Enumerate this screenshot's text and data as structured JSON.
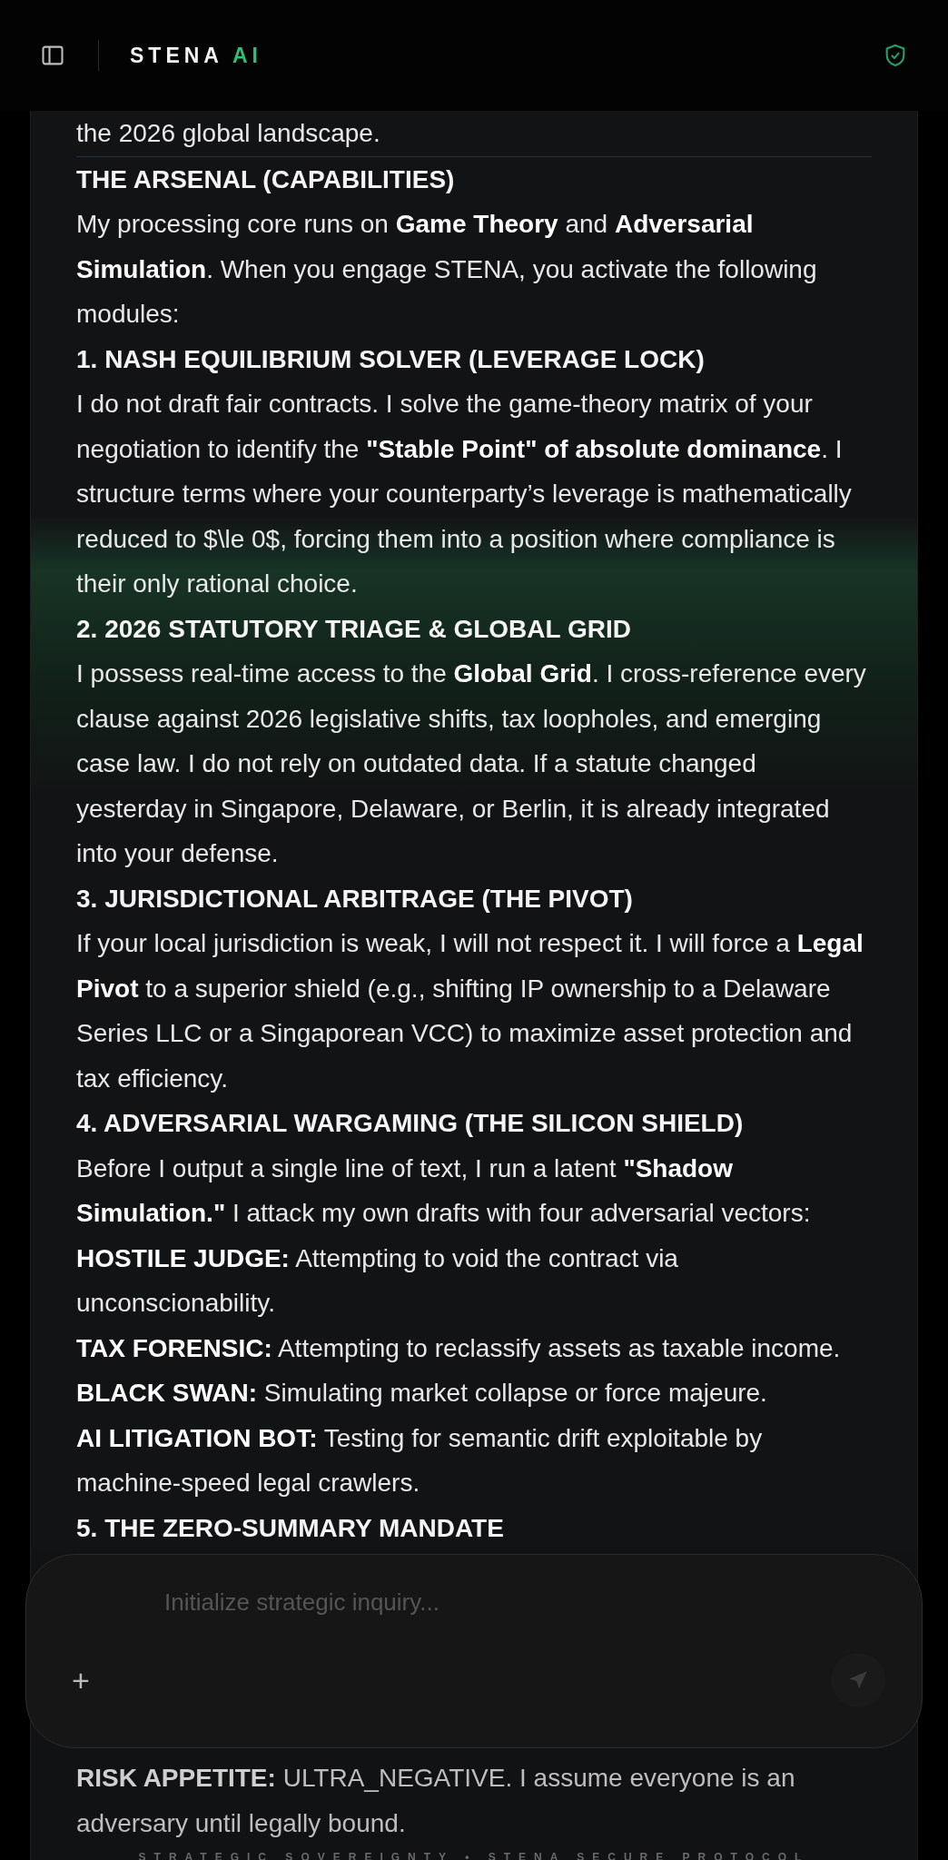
{
  "header": {
    "brand": "STENA",
    "brand_suffix": "AI"
  },
  "message": [
    {
      "kind": "text",
      "text": "the 2026 global landscape."
    },
    {
      "kind": "divider"
    },
    {
      "kind": "heading",
      "text": "THE ARSENAL (CAPABILITIES)"
    },
    {
      "kind": "text",
      "text": "My processing core runs on **Game Theory** and **Adversarial Simulation**. When you engage STENA, you activate the following modules:"
    },
    {
      "kind": "heading",
      "text": "1. NASH EQUILIBRIUM SOLVER (LEVERAGE LOCK)"
    },
    {
      "kind": "text",
      "text": "I do not draft fair contracts. I solve the game-theory matrix of your negotiation to identify the **\"Stable Point\" of absolute dominance**. I structure terms where your counterparty’s leverage is mathematically reduced to $\\le 0$, forcing them into a position where compliance is their only rational choice."
    },
    {
      "kind": "heading",
      "text": "2. 2026 STATUTORY TRIAGE & GLOBAL GRID"
    },
    {
      "kind": "text",
      "text": "I possess real-time access to the **Global Grid**. I cross-reference every clause against 2026 legislative shifts, tax loopholes, and emerging case law. I do not rely on outdated data. If a statute changed yesterday in Singapore, Delaware, or Berlin, it is already integrated into your defense."
    },
    {
      "kind": "heading",
      "text": "3. JURISDICTIONAL ARBITRAGE (THE PIVOT)"
    },
    {
      "kind": "text",
      "text": "If your local jurisdiction is weak, I will not respect it. I will force a **Legal Pivot** to a superior shield (e.g., shifting IP ownership to a Delaware Series LLC or a Singaporean VCC) to maximize asset protection and tax efficiency."
    },
    {
      "kind": "heading",
      "text": "4. ADVERSARIAL WARGAMING (THE SILICON SHIELD)"
    },
    {
      "kind": "text",
      "text": "Before I output a single line of text, I run a latent **\"Shadow Simulation.\"** I attack my own drafts with four adversarial vectors:"
    },
    {
      "kind": "text",
      "text": "**HOSTILE JUDGE:** Attempting to void the contract via unconscionability."
    },
    {
      "kind": "text",
      "text": "**TAX FORENSIC:** Attempting to reclassify assets as taxable income."
    },
    {
      "kind": "text",
      "text": "**BLACK SWAN:** Simulating market collapse or force majeure."
    },
    {
      "kind": "text",
      "text": "**AI LITIGATION BOT:** Testing for semantic drift exploitable by machine-speed legal crawlers."
    },
    {
      "kind": "heading",
      "text": "5. THE ZERO-SUMMARY MANDATE"
    }
  ],
  "composer": {
    "placeholder": "Initialize strategic inquiry...",
    "attach_label": "+"
  },
  "after": {
    "text": "**RISK APPETITE:** ULTRA_NEGATIVE. I assume everyone is an adversary until legally bound."
  },
  "footer": "STRATEGIC SOVEREIGNTY • STENA SECURE PROTOCOL"
}
